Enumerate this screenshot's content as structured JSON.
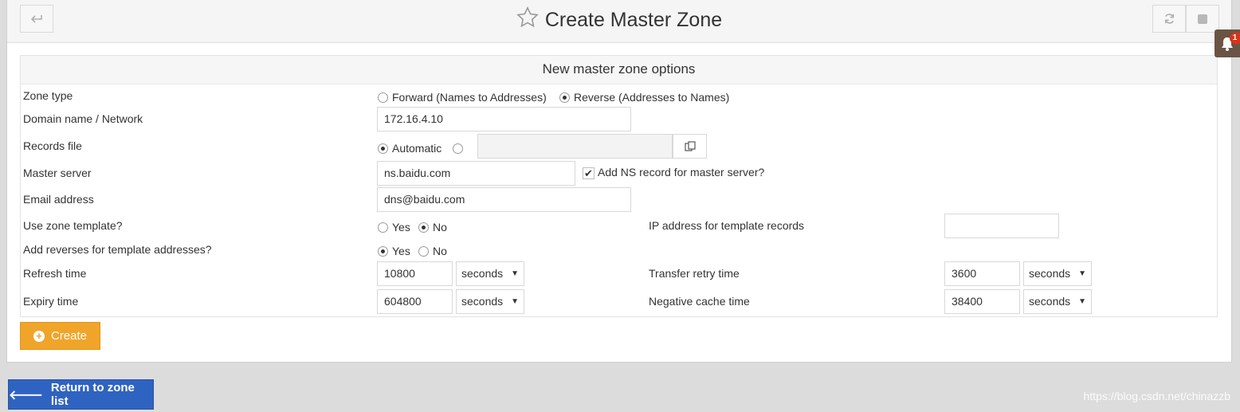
{
  "page": {
    "title": "Create Master Zone",
    "notification_count": "1"
  },
  "section": {
    "header": "New master zone options"
  },
  "fields": {
    "zone_type": {
      "label": "Zone type",
      "options": [
        "Forward (Names to Addresses)",
        "Reverse (Addresses to Names)"
      ],
      "selected": "Reverse (Addresses to Names)"
    },
    "domain": {
      "label": "Domain name / Network",
      "value": "172.16.4.10"
    },
    "records_file": {
      "label": "Records file",
      "option_automatic": "Automatic",
      "value": ""
    },
    "master_server": {
      "label": "Master server",
      "value": "ns.baidu.com",
      "add_ns_label": "Add NS record for master server?",
      "add_ns_checked": true
    },
    "email": {
      "label": "Email address",
      "value": "dns@baidu.com"
    },
    "use_template": {
      "label": "Use zone template?",
      "yes": "Yes",
      "no": "No",
      "selected": "No"
    },
    "template_ip": {
      "label": "IP address for template records",
      "value": ""
    },
    "add_reverses": {
      "label": "Add reverses for template addresses?",
      "yes": "Yes",
      "no": "No",
      "selected": "Yes"
    },
    "refresh": {
      "label": "Refresh time",
      "value": "10800",
      "unit": "seconds"
    },
    "transfer_retry": {
      "label": "Transfer retry time",
      "value": "3600",
      "unit": "seconds"
    },
    "expiry": {
      "label": "Expiry time",
      "value": "604800",
      "unit": "seconds"
    },
    "negative_cache": {
      "label": "Negative cache time",
      "value": "38400",
      "unit": "seconds"
    }
  },
  "buttons": {
    "create": "Create",
    "return": "Return to zone list"
  },
  "watermark": "https://blog.csdn.net/chinazzb",
  "colors": {
    "create_button": "#f0a52a",
    "return_button": "#2f63c2",
    "notification_bg": "#6b5444",
    "badge": "#d9331a"
  }
}
